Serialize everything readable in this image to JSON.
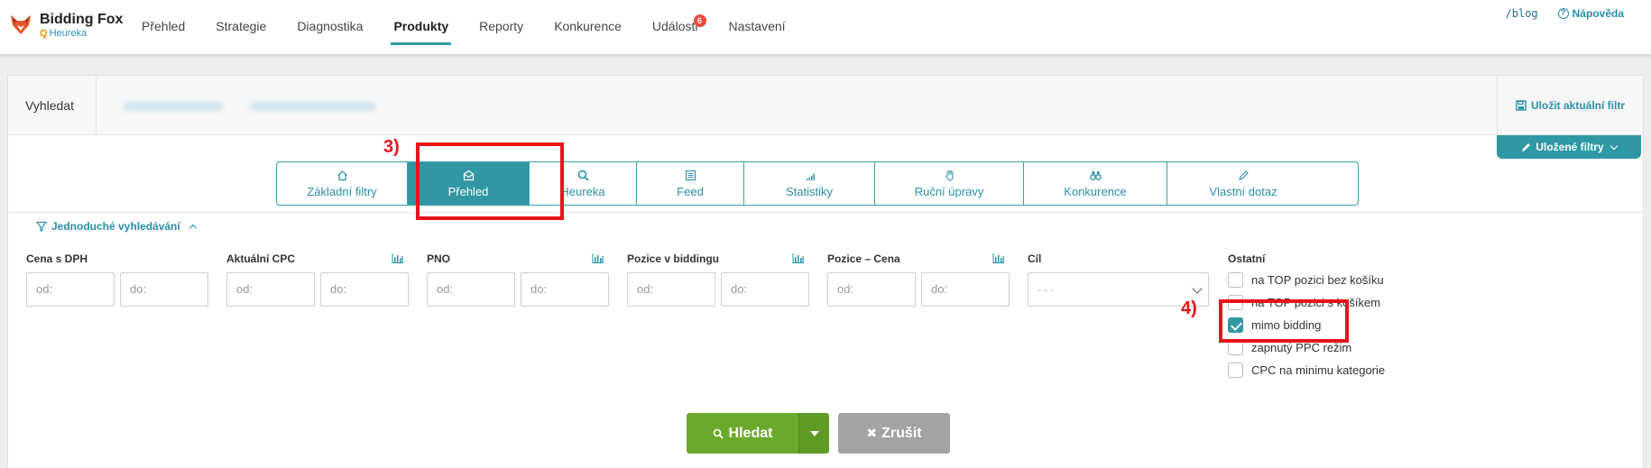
{
  "brand": {
    "title": "Bidding Fox",
    "sub": "Heureka"
  },
  "nav": [
    {
      "label": "Přehled"
    },
    {
      "label": "Strategie"
    },
    {
      "label": "Diagnostika"
    },
    {
      "label": "Produkty",
      "active": true
    },
    {
      "label": "Reporty"
    },
    {
      "label": "Konkurence"
    },
    {
      "label": "Události",
      "badge": "6"
    },
    {
      "label": "Nastavení"
    }
  ],
  "top_right": {
    "blog": "/blog",
    "help": "Nápověda"
  },
  "search": {
    "label": "Vyhledat",
    "save_filter": "Uložit aktuální filtr",
    "saved_filters": "Uložené filtry"
  },
  "tabs": [
    {
      "label": "Základní filtry",
      "icon": "home-icon"
    },
    {
      "label": "Přehled",
      "icon": "envelope-open-icon",
      "active": true
    },
    {
      "label": "Heureka",
      "icon": "magnifier-icon"
    },
    {
      "label": "Feed",
      "icon": "list-icon"
    },
    {
      "label": "Statistiky",
      "icon": "signal-icon"
    },
    {
      "label": "Ruční úpravy",
      "icon": "hand-icon"
    },
    {
      "label": "Konkurence",
      "icon": "binoculars-icon"
    },
    {
      "label": "Vlastní dotaz",
      "icon": "pencil-icon"
    }
  ],
  "annotations": {
    "step3": "3)",
    "step4": "4)"
  },
  "simple_search": "Jednoduché vyhledávání",
  "filters": {
    "cena": {
      "label": "Cena s DPH",
      "from": "od:",
      "to": "do:"
    },
    "cpc": {
      "label": "Aktuální CPC",
      "from": "od:",
      "to": "do:"
    },
    "pno": {
      "label": "PNO",
      "from": "od:",
      "to": "do:"
    },
    "pozice_bidding": {
      "label": "Pozice v biddingu",
      "from": "od:",
      "to": "do:"
    },
    "pozice_cena": {
      "label": "Pozice – Cena",
      "from": "od:",
      "to": "do:"
    },
    "cil": {
      "label": "Cíl",
      "value": "- - -"
    },
    "ostatni": {
      "label": "Ostatní",
      "items": [
        {
          "label": "na TOP pozici bez košíku",
          "checked": false
        },
        {
          "label": "na TOP pozici s košíkem",
          "checked": false
        },
        {
          "label": "mimo bidding",
          "checked": true
        },
        {
          "label": "zapnutý PPC režim",
          "checked": false
        },
        {
          "label": "CPC na minimu kategorie",
          "checked": false
        }
      ]
    }
  },
  "buttons": {
    "search": "Hledat",
    "cancel": "Zrušit"
  },
  "colors": {
    "accent": "#3197a3",
    "search": "#6ba92c",
    "cancel": "#a3a3a3",
    "highlight": "#e8141a"
  }
}
